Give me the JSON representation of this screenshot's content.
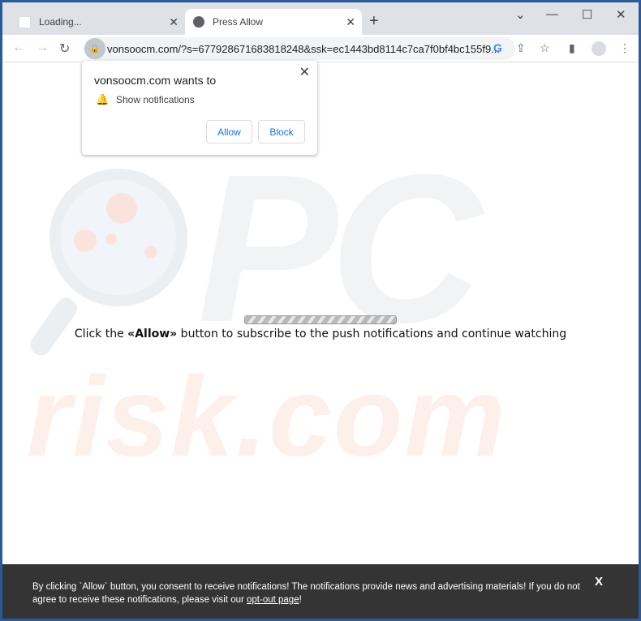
{
  "tabs": [
    {
      "label": "Loading...",
      "close": "✕"
    },
    {
      "label": "Press Allow",
      "close": "✕"
    }
  ],
  "new_tab": "+",
  "window_controls": {
    "dropdown": "⌄",
    "minimize": "—",
    "maximize": "☐",
    "close": "✕"
  },
  "address_bar": {
    "url": "vonsoocm.com/?s=677928671683818248&ssk=ec1443bd8114c7ca7f0bf4bc155f9..."
  },
  "popup": {
    "title": "vonsoocm.com wants to",
    "permission": "Show notifications",
    "allow": "Allow",
    "block": "Block",
    "close": "✕"
  },
  "page": {
    "progress_percent": 100,
    "msg_before": "Click the ",
    "msg_bold": "«Allow»",
    "msg_after": " button to subscribe to the push notifications and continue watching"
  },
  "watermark": {
    "logo_top": "PC",
    "logo_bottom": "risk.com"
  },
  "footer": {
    "text": "By clicking `Allow` button, you consent to receive notifications! The notifications provide news and advertising materials! If you do not agree to receive these notifications, please visit our ",
    "link": "opt-out page",
    "end": "!",
    "close": "X"
  }
}
